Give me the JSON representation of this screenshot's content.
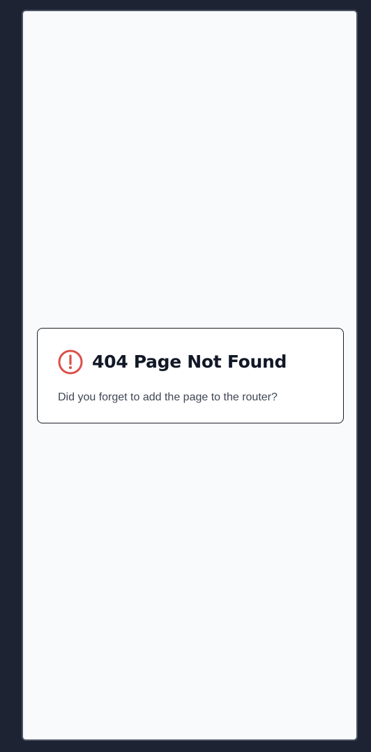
{
  "error": {
    "title": "404 Page Not Found",
    "message": "Did you forget to add the page to the router?",
    "icon": "alert-circle-icon"
  },
  "colors": {
    "background": "#1e2333",
    "frame": "#f8fafc",
    "card": "#ffffff",
    "title": "#121826",
    "message": "#3f4654",
    "alert": "#dc4f4a"
  }
}
